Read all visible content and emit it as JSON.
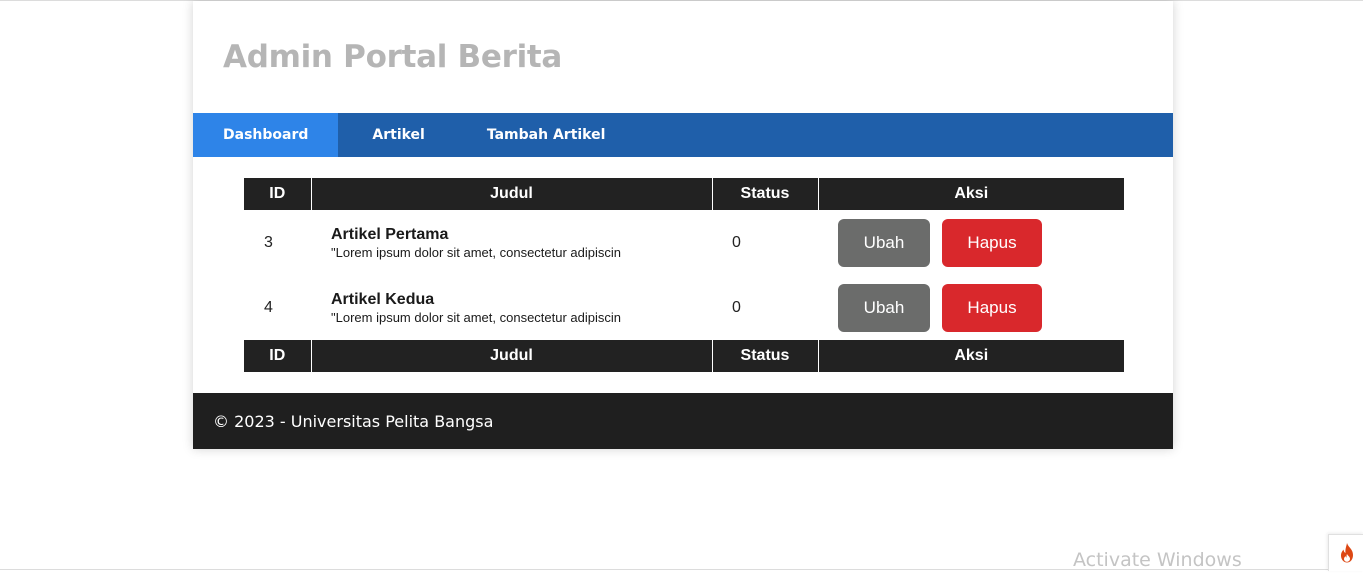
{
  "header": {
    "title": "Admin Portal Berita"
  },
  "nav": {
    "items": [
      {
        "label": "Dashboard",
        "active": true
      },
      {
        "label": "Artikel",
        "active": false
      },
      {
        "label": "Tambah Artikel",
        "active": false
      }
    ]
  },
  "table": {
    "columns": [
      "ID",
      "Judul",
      "Status",
      "Aksi"
    ],
    "rows": [
      {
        "id": "3",
        "title": "Artikel Pertama",
        "excerpt": "\"Lorem ipsum dolor sit amet, consectetur adipiscin",
        "status": "0",
        "edit_label": "Ubah",
        "delete_label": "Hapus"
      },
      {
        "id": "4",
        "title": "Artikel Kedua",
        "excerpt": "\"Lorem ipsum dolor sit amet, consectetur adipiscin",
        "status": "0",
        "edit_label": "Ubah",
        "delete_label": "Hapus"
      }
    ]
  },
  "footer": {
    "text": "© 2023 - Universitas Pelita Bangsa"
  },
  "watermark": {
    "text": "Activate Windows"
  },
  "colors": {
    "nav_bg": "#1f5faa",
    "nav_active": "#2e84e8",
    "btn_ubah": "#6b6c6b",
    "btn_hapus": "#d9282c",
    "footer_bg": "#1f1f1f",
    "table_header_bg": "#222222",
    "debug_icon": "#dd4814"
  },
  "icons": {
    "debug_toolbar": "flame-icon"
  }
}
